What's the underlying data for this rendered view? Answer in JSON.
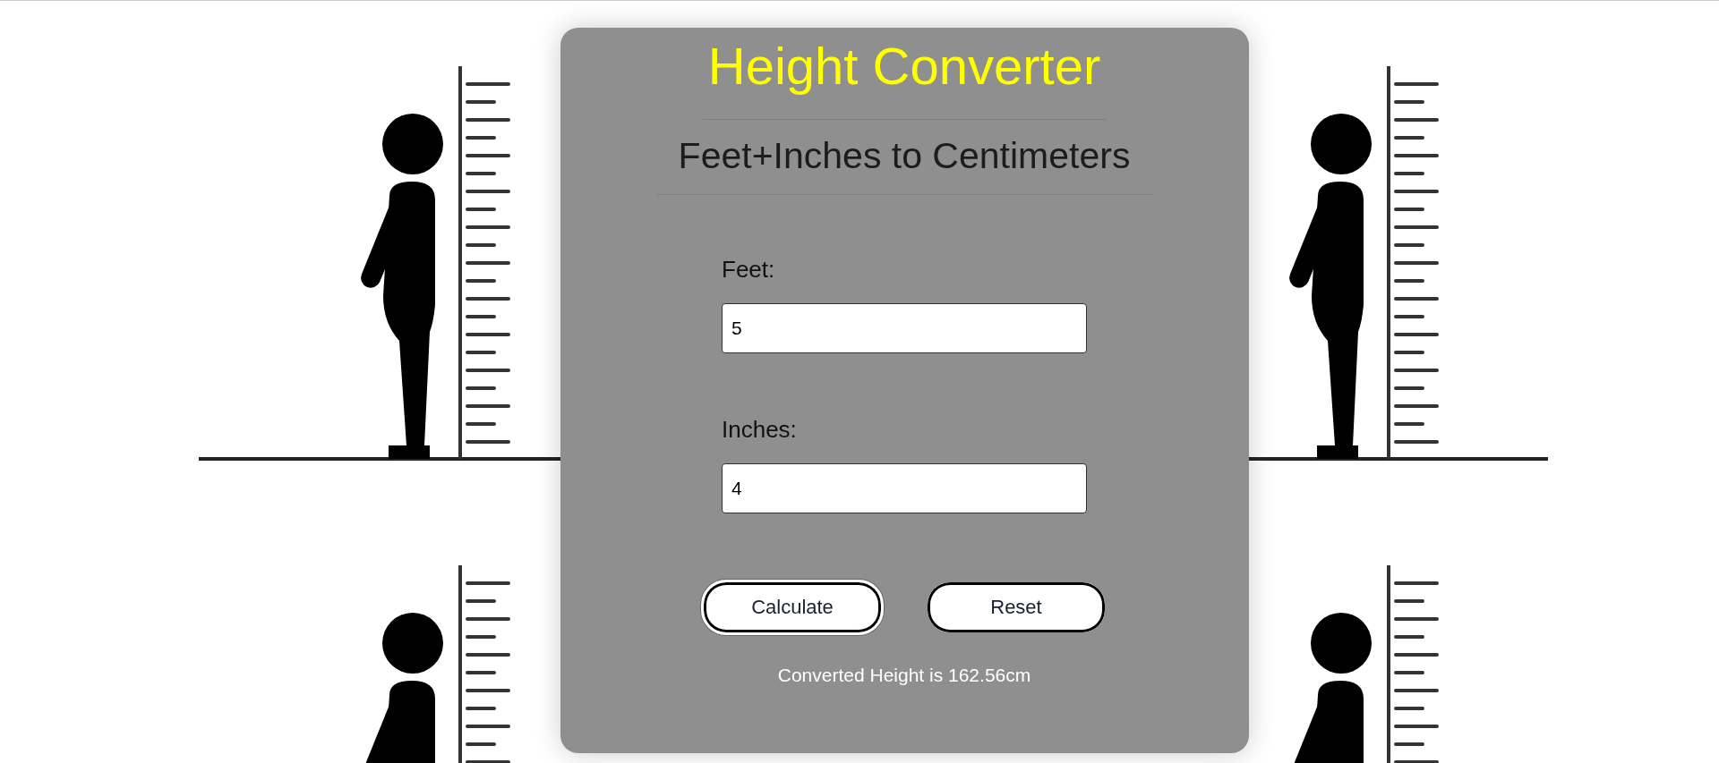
{
  "title": "Height Converter",
  "subtitle": "Feet+Inches to Centimeters",
  "fields": [
    {
      "label": "Feet:",
      "value": "5"
    },
    {
      "label": "Inches:",
      "value": "4"
    }
  ],
  "buttons": [
    {
      "label": "Calculate",
      "focused": true
    },
    {
      "label": "Reset",
      "focused": false
    }
  ],
  "result": "Converted Height is 162.56cm"
}
